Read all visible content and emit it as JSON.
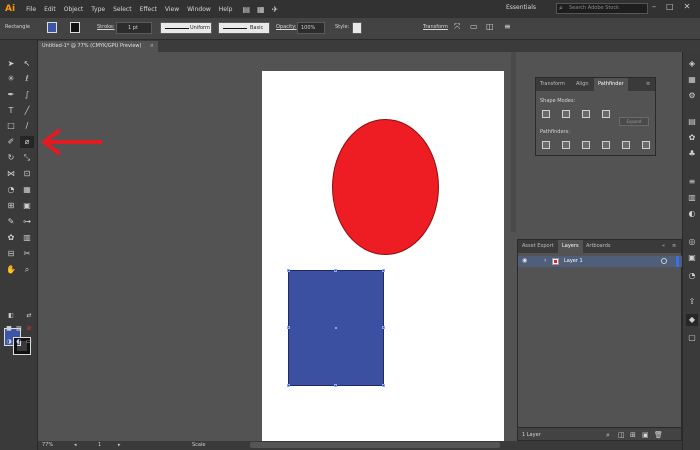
{
  "menubar": {
    "logo": "Ai",
    "items": [
      "File",
      "Edit",
      "Object",
      "Type",
      "Select",
      "Effect",
      "View",
      "Window",
      "Help"
    ],
    "workspace": "Essentials",
    "search_placeholder": "Search Adobe Stock"
  },
  "controlbar": {
    "selection_label": "Rectangle",
    "stroke_label": "Stroke:",
    "stroke_weight": "1 pt",
    "profile_label": "Uniform",
    "brush_label": "Basic",
    "opacity_label": "Opacity:",
    "opacity_value": "100%",
    "style_label": "Style:",
    "transform_label": "Transform"
  },
  "document_tab": {
    "title": "Untitled-1* @ 77% (CMYK/GPU Preview)",
    "close": "×"
  },
  "colors": {
    "fill": "#3c55a5",
    "stroke": "#111111",
    "circle": "#ee1c23",
    "square": "#3c50a2",
    "arrow": "#e01b22"
  },
  "pathfinder_panel": {
    "tabs": [
      "Transform",
      "Align",
      "Pathfinder"
    ],
    "active_tab": "Pathfinder",
    "shape_modes_label": "Shape Modes:",
    "pathfinders_label": "Pathfinders:",
    "expand_label": "Expand"
  },
  "layers_panel": {
    "tabs": [
      "Asset Export",
      "Layers",
      "Artboards"
    ],
    "active_tab": "Layers",
    "layer_name": "Layer 1",
    "footer_count": "1 Layer"
  },
  "statusbar": {
    "zoom": "77%",
    "page": "1",
    "tool_name": "Scale"
  }
}
